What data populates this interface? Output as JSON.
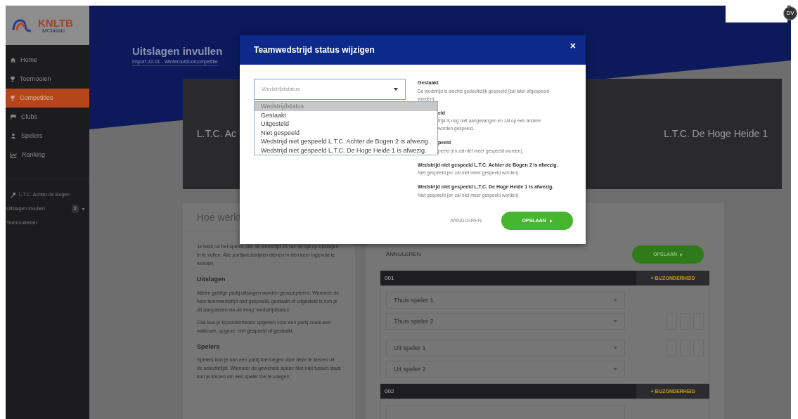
{
  "logo": {
    "text": "KNLTB",
    "subtext": "MClassic"
  },
  "sidebar": {
    "items": [
      {
        "label": "Home",
        "selected": false
      },
      {
        "label": "Toernooien",
        "selected": false
      },
      {
        "label": "Competities",
        "selected": true
      },
      {
        "label": "Clubs",
        "selected": false
      },
      {
        "label": "Spelers",
        "selected": false
      },
      {
        "label": "Ranking",
        "selected": false
      }
    ],
    "club": "L.T.C. Achter de Bogen",
    "submenu": [
      {
        "label": "Uitslagen invullen",
        "badge": "2",
        "caret": true
      },
      {
        "label": "Toernooileider",
        "caret": false
      }
    ]
  },
  "topbar": {
    "user": "DV"
  },
  "page": {
    "title": "Uitslagen invullen",
    "subtitle": "Import 22-01 - Winteroutdoorcompetitie"
  },
  "match": {
    "home_team": "L.T.C. Ac",
    "away_team": "L.T.C. De Hoge Heide 1"
  },
  "help": {
    "title": "Hoe werkt",
    "intro": "Je hebt na het spelen van de wedstrijd 24 uur de tijd op uitslagen in te vullen. Alle partijwedstrijden dienen in één keer ingevuld te worden.",
    "sections": [
      {
        "heading": "Uitslagen",
        "paragraphs": [
          "Alleen geldige partij uitslagen worden geaccepteerd. Wanneer de hele teamwedstrijd niet gespeeld, gestaakt of uitgesteld is kun je dit aanpassen via de knop 'wedstrijdstatus'",
          "Ook kun je bijzonderheden opgeven voor een partij zoals een walkover, opgave, niet gespeeld of gestaakt."
        ]
      },
      {
        "heading": "Spelers",
        "paragraphs": [
          "Spelers kun je aan een partij toevoegen door deze te kiezen uit de selectielijst. Wanneer de gewenste speler hier niet tussen staat kun je kiezen om een speler toe te voegen."
        ]
      }
    ]
  },
  "results": {
    "cancel": "ANNULEREN",
    "save": "OPSLAAN",
    "matches": [
      {
        "code": "001",
        "action": "+ BIJZONDERHEID",
        "fields": [
          "Thuis speler 1",
          "Thuis speler 2",
          "Uit speler 1",
          "Uit speler 2"
        ]
      },
      {
        "code": "002",
        "action": "+ BIJZONDERHEID"
      }
    ]
  },
  "modal": {
    "title": "Teamwedstrijd status wijzigen",
    "close": "×",
    "select": {
      "placeholder": "Wedstrijdstatus",
      "expanded": true
    },
    "options": [
      {
        "label": "Wedstrijdstatus",
        "selected": true
      },
      {
        "label": "Gestaakt",
        "selected": false
      },
      {
        "label": "Uitgesteld",
        "selected": false
      },
      {
        "label": "Niet gespeeld",
        "selected": false
      },
      {
        "label": "Wedstrijd niet gespeeld L.T.C. Achter de Bogen 2 is afwezig.",
        "selected": false
      },
      {
        "label": "Wedstrijd niet gespeeld L.T.C. De Hoge Heide 1 is afwezig.",
        "selected": false
      }
    ],
    "descriptions": [
      {
        "kind": "full",
        "title": "Gestaakt",
        "lines": [
          "De wedstrijd is slechts gedeeltelijk gespeeld (zal later afgespeeld",
          "worden)."
        ]
      },
      {
        "kind": "partial",
        "title": "eld",
        "lines": [
          "trijd is nog niet aangevangen en zal op een andere",
          "worden gespeeld."
        ]
      },
      {
        "kind": "partial",
        "title": "peeld",
        "lines": [
          "peeld (en zal niet meer gespeeld worden)."
        ]
      },
      {
        "kind": "full",
        "title": "Wedstrijd niet gespeeld L.T.C. Achter de Bogen 2 is afwezig.",
        "lines": [
          "Niet gespeeld (en zal niet meer gespeeld worden)."
        ]
      },
      {
        "kind": "full",
        "title": "Wedstrijd niet gespeeld L.T.C. De Hoge Heide 1 is afwezig.",
        "lines": [
          "Niet gespeeld (en zal niet meer gespeeld worden)."
        ]
      }
    ],
    "cancel": "ANNULEREN",
    "save": "OPSLAAN"
  }
}
